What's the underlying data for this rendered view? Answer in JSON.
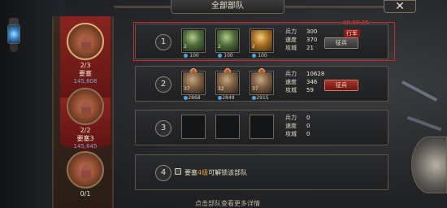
{
  "title": "全部部队",
  "close_icon": "close-icon",
  "tabs": [
    {
      "count": "2/3",
      "name": "要塞",
      "coord": "145,608",
      "active": true
    },
    {
      "count": "2/2",
      "name": "要塞3",
      "coord": "145,645",
      "active": false
    },
    {
      "count": "0/1",
      "name": "",
      "coord": "",
      "active": false
    }
  ],
  "rows": [
    {
      "num": "1",
      "heroes": [
        {
          "level": "2",
          "qty": "100"
        },
        {
          "level": "2",
          "qty": "100"
        },
        {
          "level": "2",
          "qty": "100"
        }
      ],
      "stats": {
        "power_label": "兵力",
        "power": "300",
        "speed_label": "速度",
        "speed": "370",
        "siege_label": "攻城",
        "siege": "21"
      },
      "timer": "00:00:25",
      "tag": "行军",
      "button": "征兵"
    },
    {
      "num": "2",
      "heroes": [
        {
          "level": "37",
          "qty": "2868"
        },
        {
          "level": "32",
          "qty": "2849"
        },
        {
          "level": "37",
          "qty": "2915"
        }
      ],
      "stats": {
        "power_label": "兵力",
        "power": "10628",
        "speed_label": "速度",
        "speed": "346",
        "siege_label": "攻城",
        "siege": "59"
      },
      "button": "征兵"
    },
    {
      "num": "3",
      "stats": {
        "power_label": "兵力",
        "power": "0",
        "speed_label": "速度",
        "speed": "0",
        "siege_label": "攻城",
        "siege": "0"
      }
    },
    {
      "num": "4",
      "lock_prefix": "要塞",
      "lock_level": "4级",
      "lock_suffix": "可解锁该部队"
    }
  ],
  "bottom_hint": "点击部队查看更多详情"
}
